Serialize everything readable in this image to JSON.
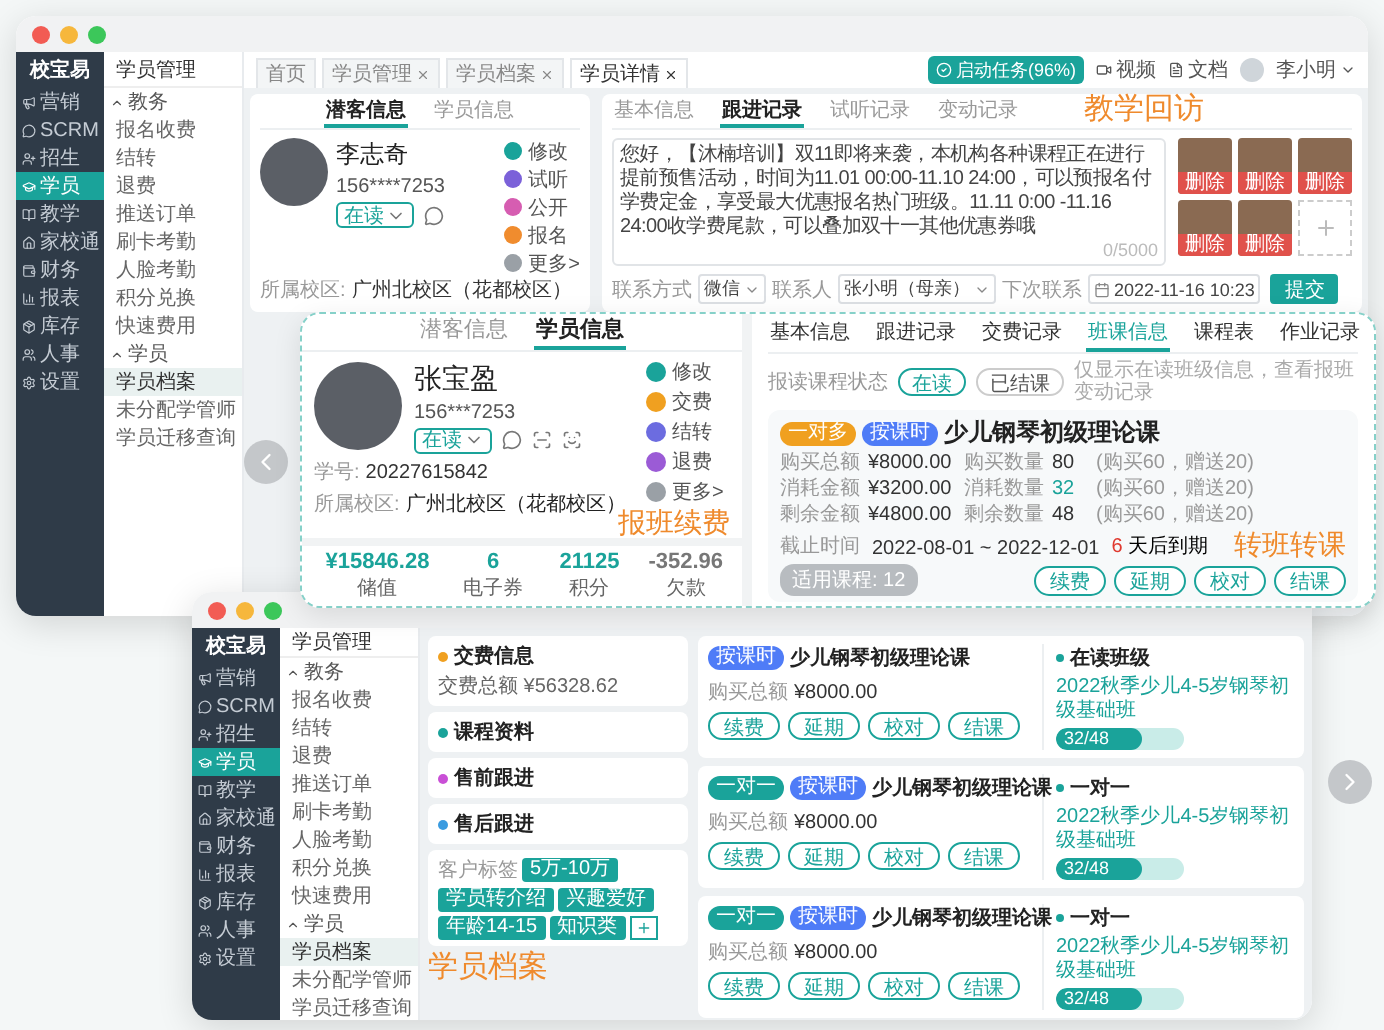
{
  "back_window": {
    "logo": "校宝易",
    "nav": [
      {
        "label": "营销",
        "selected": false
      },
      {
        "label": "SCRM",
        "selected": false
      },
      {
        "label": "招生",
        "selected": false
      },
      {
        "label": "学员",
        "selected": true
      },
      {
        "label": "教学",
        "selected": false
      },
      {
        "label": "家校通",
        "selected": false
      },
      {
        "label": "财务",
        "selected": false
      },
      {
        "label": "报表",
        "selected": false
      },
      {
        "label": "库存",
        "selected": false
      },
      {
        "label": "人事",
        "selected": false
      },
      {
        "label": "设置",
        "selected": false
      }
    ],
    "menu": {
      "title": "学员管理",
      "groups": [
        {
          "label": "教务",
          "expanded": true,
          "items": [
            {
              "label": "报名收费",
              "selected": false
            },
            {
              "label": "结转",
              "selected": false
            },
            {
              "label": "退费",
              "selected": false
            },
            {
              "label": "推送订单",
              "selected": false
            },
            {
              "label": "刷卡考勤",
              "selected": false
            },
            {
              "label": "人脸考勤",
              "selected": false
            },
            {
              "label": "积分兑换",
              "selected": false
            },
            {
              "label": "快速费用",
              "selected": false
            }
          ]
        },
        {
          "label": "学员",
          "expanded": true,
          "items": [
            {
              "label": "学员档案",
              "selected": true
            },
            {
              "label": "未分配学管师",
              "selected": false
            },
            {
              "label": "学员迁移查询",
              "selected": false
            }
          ]
        }
      ]
    },
    "tabs": [
      {
        "label": "首页",
        "selected": false,
        "closable": false
      },
      {
        "label": "学员管理",
        "selected": false,
        "closable": true
      },
      {
        "label": "学员档案",
        "selected": false,
        "closable": true
      },
      {
        "label": "学员详情",
        "selected": true,
        "closable": true
      }
    ],
    "task_button": "启动任务(96%)",
    "links": [
      "视频",
      "文档"
    ],
    "user": "李小明",
    "profile": {
      "tabs": [
        {
          "label": "潜客信息",
          "selected": true
        },
        {
          "label": "学员信息",
          "selected": false
        }
      ],
      "name": "李志奇",
      "phone": "156****7253",
      "status": "在读",
      "actions": [
        {
          "label": "修改",
          "color": "#1aa39a"
        },
        {
          "label": "试听",
          "color": "#7b61d9"
        },
        {
          "label": "公开",
          "color": "#d65db1"
        },
        {
          "label": "报名",
          "color": "#f08c2e"
        },
        {
          "label": "更多>",
          "color": "#9aa0a6"
        }
      ],
      "campus_label": "所属校区:",
      "campus": "广州北校区（花都校区）"
    },
    "follow_up": {
      "caption": "教学回访",
      "tabs": [
        {
          "label": "基本信息",
          "selected": false
        },
        {
          "label": "跟进记录",
          "selected": true
        },
        {
          "label": "试听记录",
          "selected": false
        },
        {
          "label": "变动记录",
          "selected": false
        }
      ],
      "message": "您好，【沐楠培训】双11即将来袭，本机构各种课程正在进行提前预售活动，时间为11.01 00:00-11.10 24:00，可以预报名付学费定金，享受最大优惠报名热门班级。11.11 0:00 -11.16 24:00收学费尾款，可以叠加双十一其他优惠券哦",
      "counter": "0/5000",
      "photos": [
        {
          "delete": "删除"
        },
        {
          "delete": "删除"
        },
        {
          "delete": "删除"
        },
        {
          "delete": "删除"
        },
        {
          "delete": "删除"
        }
      ],
      "fields": [
        {
          "label": "联系方式",
          "value": "微信",
          "kind": "select"
        },
        {
          "label": "联系人",
          "value": "张小明（母亲）",
          "kind": "select"
        },
        {
          "label": "下次联系",
          "value": "2022-11-16 10:23",
          "kind": "date"
        }
      ],
      "submit": "提交"
    }
  },
  "student_card": {
    "tabs": [
      {
        "label": "潜客信息",
        "selected": false
      },
      {
        "label": "学员信息",
        "selected": true
      }
    ],
    "name": "张宝盈",
    "phone": "156***7253",
    "status": "在读",
    "actions": [
      {
        "label": "修改",
        "color": "#1aa39a"
      },
      {
        "label": "交费",
        "color": "#f0a020"
      },
      {
        "label": "结转",
        "color": "#6c6ce0"
      },
      {
        "label": "退费",
        "color": "#9b5bd6"
      },
      {
        "label": "更多>",
        "color": "#9aa0a6"
      }
    ],
    "student_no_label": "学号:",
    "student_no": "20227615842",
    "campus_label": "所属校区:",
    "campus": "广州北校区（花都校区）",
    "caption": "报班续费",
    "stats": [
      {
        "value": "¥15846.28",
        "label": "储值",
        "kind": "balance"
      },
      {
        "value": "6",
        "label": "电子券",
        "kind": "balance"
      },
      {
        "value": "21125",
        "label": "积分",
        "kind": "balance"
      },
      {
        "value": "-352.96",
        "label": "欠款",
        "kind": "debt"
      }
    ],
    "detail_tabs": [
      {
        "label": "基本信息",
        "selected": false
      },
      {
        "label": "跟进记录",
        "selected": false
      },
      {
        "label": "交费记录",
        "selected": false
      },
      {
        "label": "班课信息",
        "selected": true
      },
      {
        "label": "课程表",
        "selected": false
      },
      {
        "label": "作业记录",
        "selected": false
      }
    ],
    "filter_label": "报读课程状态",
    "filters": [
      {
        "label": "在读",
        "selected": true
      },
      {
        "label": "已结课",
        "selected": false
      }
    ],
    "hint": "仅显示在读班级信息，查看报班变动记录",
    "course": {
      "tags": [
        {
          "text": "一对多",
          "color": "#f0a020"
        },
        {
          "text": "按课时",
          "color": "#4f7cf7"
        }
      ],
      "title": "少儿钢琴初级理论课",
      "rows": [
        {
          "label": "购买总额",
          "value": "¥8000.00",
          "qty_label": "购买数量",
          "qty": "80",
          "highlight": false,
          "note": "(购买60，赠送20)"
        },
        {
          "label": "消耗金额",
          "value": "¥3200.00",
          "qty_label": "消耗数量",
          "qty": "32",
          "highlight": true,
          "note": "(购买60，赠送20)"
        },
        {
          "label": "剩余金额",
          "value": "¥4800.00",
          "qty_label": "剩余数量",
          "qty": "48",
          "highlight": false,
          "note": "(购买60，赠送20)"
        }
      ],
      "deadline_label": "截止时间",
      "deadline": "2022-08-01 ~ 2022-12-01",
      "expire_days": "6",
      "expire_text": "天后到期",
      "caption": "转班转课",
      "applicable": "适用课程: 12",
      "buttons": [
        "续费",
        "延期",
        "校对",
        "结课"
      ]
    }
  },
  "front_window": {
    "logo": "校宝易",
    "nav": [
      {
        "label": "营销",
        "selected": false
      },
      {
        "label": "SCRM",
        "selected": false
      },
      {
        "label": "招生",
        "selected": false
      },
      {
        "label": "学员",
        "selected": true
      },
      {
        "label": "教学",
        "selected": false
      },
      {
        "label": "家校通",
        "selected": false
      },
      {
        "label": "财务",
        "selected": false
      },
      {
        "label": "报表",
        "selected": false
      },
      {
        "label": "库存",
        "selected": false
      },
      {
        "label": "人事",
        "selected": false
      },
      {
        "label": "设置",
        "selected": false
      }
    ],
    "menu": {
      "title": "学员管理",
      "groups": [
        {
          "label": "教务",
          "expanded": true,
          "items": [
            {
              "label": "报名收费",
              "selected": false
            },
            {
              "label": "结转",
              "selected": false
            },
            {
              "label": "退费",
              "selected": false
            },
            {
              "label": "推送订单",
              "selected": false
            },
            {
              "label": "刷卡考勤",
              "selected": false
            },
            {
              "label": "人脸考勤",
              "selected": false
            },
            {
              "label": "积分兑换",
              "selected": false
            },
            {
              "label": "快速费用",
              "selected": false
            }
          ]
        },
        {
          "label": "学员",
          "expanded": true,
          "items": [
            {
              "label": "学员档案",
              "selected": true
            },
            {
              "label": "未分配学管师",
              "selected": false
            },
            {
              "label": "学员迁移查询",
              "selected": false
            }
          ]
        }
      ]
    },
    "info_cards": [
      {
        "title": "交费信息",
        "color": "#f0a020",
        "line": "交费总额 ¥56328.62"
      },
      {
        "title": "课程资料",
        "color": "#1aa39a"
      },
      {
        "title": "售前跟进",
        "color": "#c94fd6"
      },
      {
        "title": "售后跟进",
        "color": "#3a9be0"
      }
    ],
    "tags_label": "客户标签",
    "tags": [
      "5万-10万",
      "学员转介绍",
      "兴趣爱好",
      "年龄14-15",
      "知识类"
    ],
    "caption": "学员档案",
    "courses": [
      {
        "tags": [
          {
            "text": "按课时",
            "color": "#4f7cf7"
          }
        ],
        "title": "少儿钢琴初级理论课",
        "amount_label": "购买总额",
        "amount": "¥8000.00",
        "buttons": [
          "续费",
          "延期",
          "校对",
          "结课"
        ],
        "class_heading": "在读班级",
        "class_name": "2022秋季少儿4-5岁钢琴初级基础班",
        "progress": "32/48",
        "level": 0.67
      },
      {
        "tags": [
          {
            "text": "一对一",
            "color": "#1aa39a"
          },
          {
            "text": "按课时",
            "color": "#4f7cf7"
          }
        ],
        "title": "少儿钢琴初级理论课",
        "amount_label": "购买总额",
        "amount": "¥8000.00",
        "buttons": [
          "续费",
          "延期",
          "校对",
          "结课"
        ],
        "class_heading": "一对一",
        "class_name": "2022秋季少儿4-5岁钢琴初级基础班",
        "progress": "32/48",
        "level": 0.67
      },
      {
        "tags": [
          {
            "text": "一对一",
            "color": "#1aa39a"
          },
          {
            "text": "按课时",
            "color": "#4f7cf7"
          }
        ],
        "title": "少儿钢琴初级理论课",
        "amount_label": "购买总额",
        "amount": "¥8000.00",
        "buttons": [
          "续费",
          "延期",
          "校对",
          "结课"
        ],
        "class_heading": "一对一",
        "class_name": "2022秋季少儿4-5岁钢琴初级基础班",
        "progress": "32/48",
        "level": 0.67
      }
    ]
  }
}
